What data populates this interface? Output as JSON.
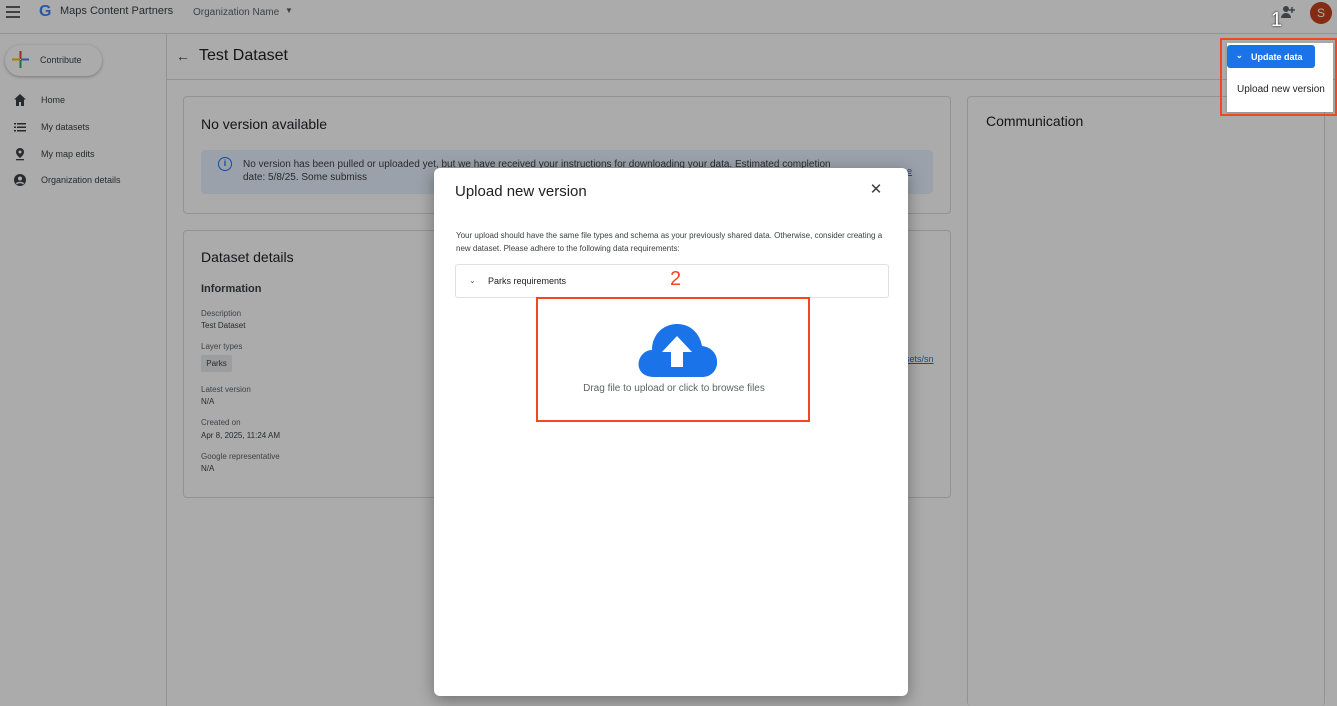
{
  "topbar": {
    "app_title": "Maps Content Partners",
    "org_name": "Organization Name",
    "avatar_letter": "S"
  },
  "sidebar": {
    "contribute_label": "Contribute",
    "items": [
      {
        "label": "Home",
        "icon": "home-icon"
      },
      {
        "label": "My datasets",
        "icon": "list-icon"
      },
      {
        "label": "My map edits",
        "icon": "pin-icon"
      },
      {
        "label": "Organization details",
        "icon": "account-icon"
      }
    ]
  },
  "page": {
    "title": "Test Dataset"
  },
  "version_card": {
    "title": "No version available",
    "banner_text": "No version has been pulled or uploaded yet, but we have received your instructions for downloading your data. Estimated completion date: 5/8/25. Some submiss",
    "banner_link": "e"
  },
  "details_card": {
    "title": "Dataset details",
    "section": "Information",
    "fields": [
      {
        "label": "Description",
        "value": "Test Dataset"
      },
      {
        "label": "Layer types",
        "value": "Parks"
      },
      {
        "label": "Latest version",
        "value": "N/A"
      },
      {
        "label": "Created on",
        "value": "Apr 8, 2025, 11:24 AM"
      },
      {
        "label": "Google representative",
        "value": "N/A"
      }
    ],
    "link_snippet": "sets/sn"
  },
  "communication_card": {
    "title": "Communication"
  },
  "update_menu": {
    "button_label": "Update data",
    "item_label": "Upload new version"
  },
  "annotations": {
    "marker_1": "1",
    "marker_2": "2",
    "box_color": "#f24822"
  },
  "dialog": {
    "title": "Upload new version",
    "description": "Your upload should have the same file types and schema as your previously shared data. Otherwise, consider creating a new dataset. Please adhere to the following data requirements:",
    "accordion_label": "Parks requirements",
    "dropzone_text": "Drag file to upload or click to browse files"
  },
  "colors": {
    "primary": "#1a73e8",
    "avatar": "#c5411e"
  }
}
